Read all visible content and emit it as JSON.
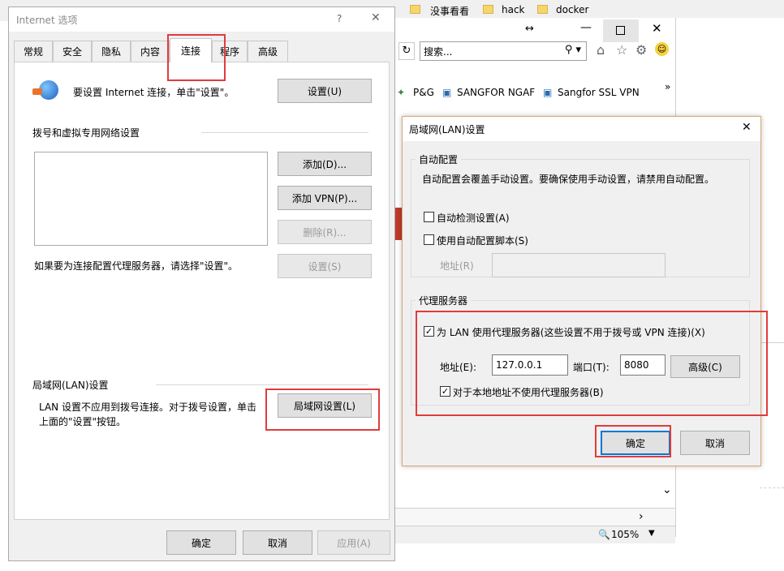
{
  "background": {
    "bookmarks": [
      "没事看看",
      "hack",
      "docker"
    ],
    "ie": {
      "search_placeholder": "搜索...",
      "favorites": [
        "P&G",
        "SANGFOR NGAF",
        "Sangfor SSL VPN"
      ],
      "zoom": "105%",
      "more": "»"
    }
  },
  "options_dialog": {
    "title": "Internet 选项",
    "help": "?",
    "close": "✕",
    "tabs": [
      "常规",
      "安全",
      "隐私",
      "内容",
      "连接",
      "程序",
      "高级"
    ],
    "active_tab": "连接",
    "setup_text": "要设置 Internet 连接，单击\"设置\"。",
    "setup_button": "设置(U)",
    "dialup_heading": "拨号和虚拟专用网络设置",
    "add_button": "添加(D)...",
    "add_vpn_button": "添加 VPN(P)...",
    "remove_button": "删除(R)...",
    "proxy_hint": "如果要为连接配置代理服务器，请选择\"设置\"。",
    "settings_button": "设置(S)",
    "lan_heading": "局域网(LAN)设置",
    "lan_text_1": "LAN 设置不应用到拨号连接。对于拨号设置，单击",
    "lan_text_2": "上面的\"设置\"按钮。",
    "lan_button": "局域网设置(L)",
    "ok": "确定",
    "cancel": "取消",
    "apply": "应用(A)"
  },
  "lan_dialog": {
    "title": "局域网(LAN)设置",
    "close": "✕",
    "auto_group": "自动配置",
    "auto_desc": "自动配置会覆盖手动设置。要确保使用手动设置，请禁用自动配置。",
    "auto_detect": "自动检测设置(A)",
    "auto_script": "使用自动配置脚本(S)",
    "address_label": "地址(R)",
    "proxy_group": "代理服务器",
    "use_proxy": "为 LAN 使用代理服务器(这些设置不用于拨号或 VPN 连接)(X)",
    "proxy_address_label": "地址(E):",
    "proxy_address": "127.0.0.1",
    "port_label": "端口(T):",
    "port": "8080",
    "advanced_button": "高级(C)",
    "bypass_local": "对于本地地址不使用代理服务器(B)",
    "ok": "确定",
    "cancel": "取消",
    "check": "✓"
  }
}
